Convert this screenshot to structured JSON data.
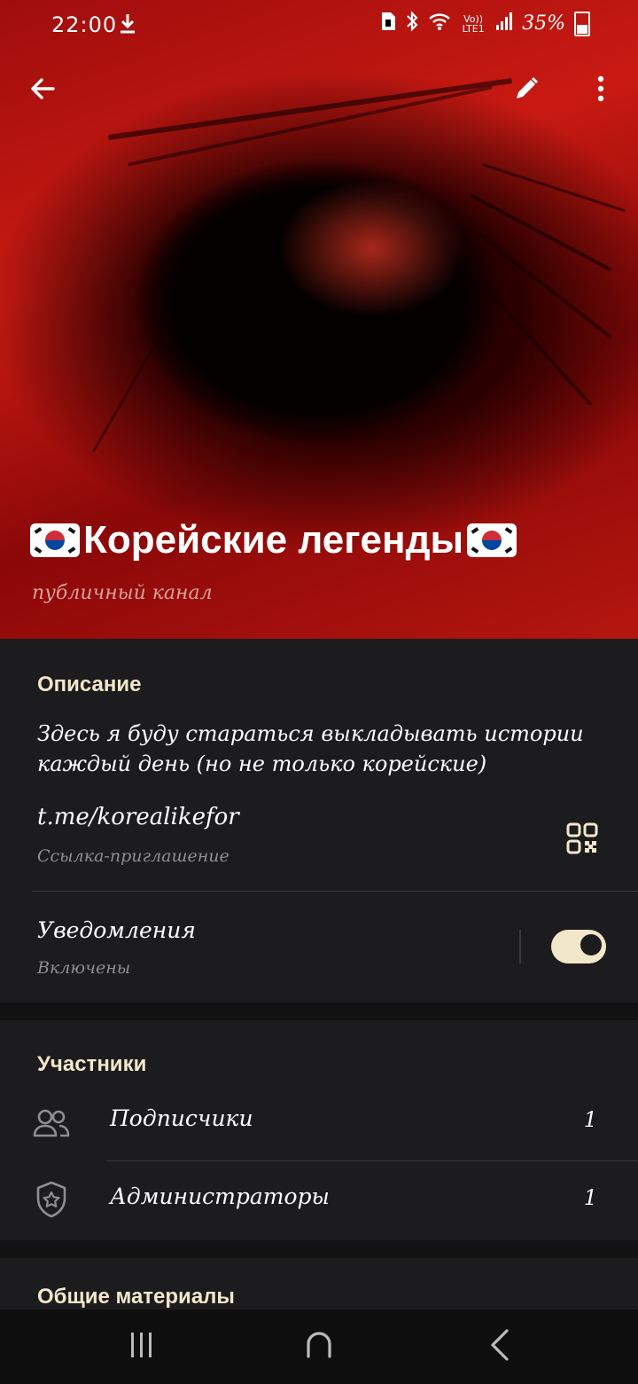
{
  "status_bar": {
    "time": "22:00",
    "download_icon": "download-icon",
    "battery": "35%",
    "icons": [
      "sim-icon",
      "bluetooth-icon",
      "wifi-icon",
      "volte-icon",
      "signal-icon",
      "battery-icon"
    ],
    "volte_text": "Vo)) LTE1"
  },
  "header": {
    "back_icon": "arrow-back-icon",
    "edit_icon": "pencil-icon",
    "more_icon": "more-vertical-icon",
    "title": "Корейские легенды",
    "flag_icon": "south-korea-flag-icon",
    "subtitle": "публичный канал"
  },
  "info": {
    "section_title": "Описание",
    "description": "Здесь я буду стараться выкладывать истории каждый день (но не только корейские)",
    "link": "t.me/korealikefor",
    "link_caption": "Ссылка-приглашение",
    "qr_icon": "qr-code-icon",
    "notifications_label": "Уведомления",
    "notifications_status": "Включены",
    "notifications_on": true
  },
  "members": {
    "section_title": "Участники",
    "items": [
      {
        "icon": "people-icon",
        "label": "Подписчики",
        "count": "1"
      },
      {
        "icon": "shield-star-icon",
        "label": "Администраторы",
        "count": "1"
      }
    ]
  },
  "media": {
    "section_title": "Общие материалы"
  },
  "nav": {
    "recents_icon": "recents-icon",
    "home_icon": "home-icon",
    "back_icon": "nav-back-icon"
  },
  "colors": {
    "accent": "#f3e7c9",
    "background": "#1c1c1e",
    "hero_red": "#c81a12"
  }
}
